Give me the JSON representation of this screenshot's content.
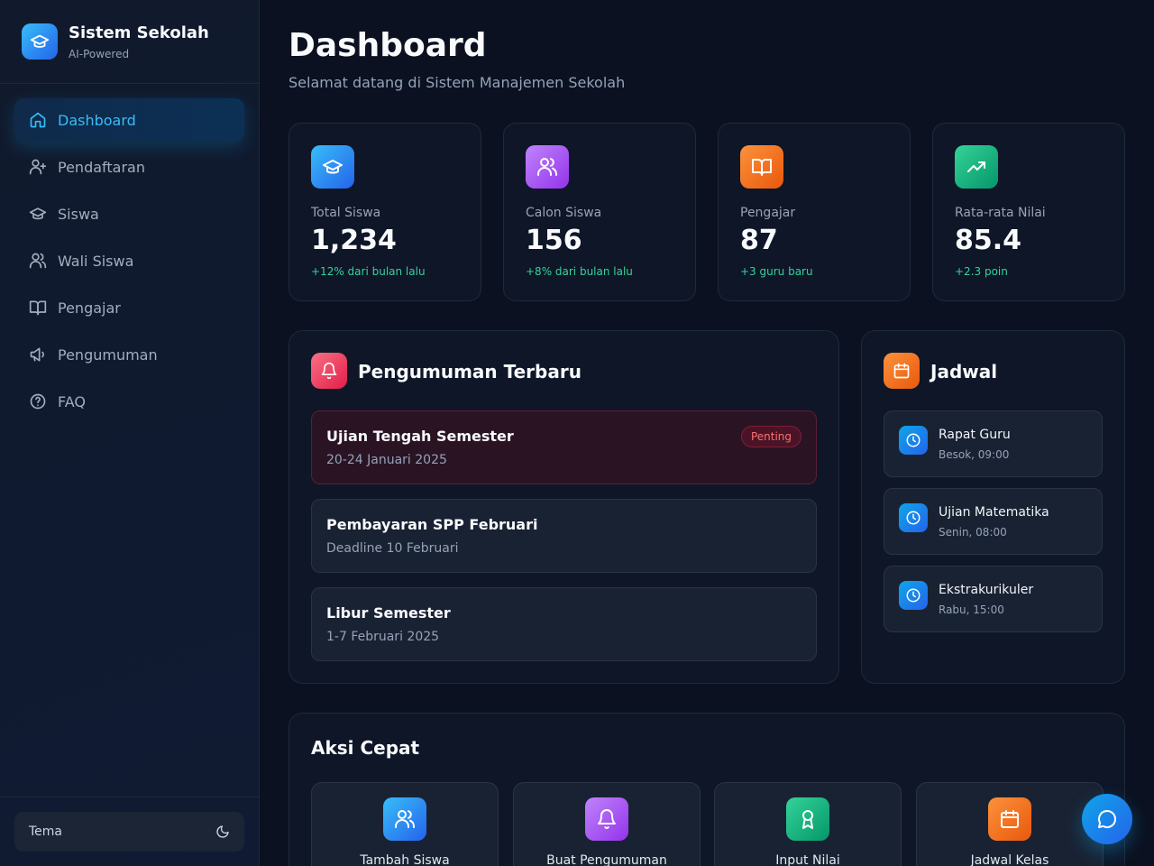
{
  "brand": {
    "title": "Sistem Sekolah",
    "subtitle": "AI-Powered"
  },
  "nav": [
    {
      "label": "Dashboard",
      "icon": "home-icon",
      "active": true
    },
    {
      "label": "Pendaftaran",
      "icon": "user-plus-icon"
    },
    {
      "label": "Siswa",
      "icon": "graduation-cap-icon"
    },
    {
      "label": "Wali Siswa",
      "icon": "users-icon"
    },
    {
      "label": "Pengajar",
      "icon": "book-open-icon"
    },
    {
      "label": "Pengumuman",
      "icon": "megaphone-icon"
    },
    {
      "label": "FAQ",
      "icon": "help-circle-icon"
    }
  ],
  "theme": {
    "label": "Tema",
    "icon": "moon-icon"
  },
  "header": {
    "title": "Dashboard",
    "subtitle": "Selamat datang di Sistem Manajemen Sekolah"
  },
  "stats": [
    {
      "label": "Total Siswa",
      "value": "1,234",
      "delta": "+12% dari bulan lalu",
      "icon": "graduation-cap-icon",
      "color": "#0ea5e9"
    },
    {
      "label": "Calon Siswa",
      "value": "156",
      "delta": "+8% dari bulan lalu",
      "icon": "users-icon",
      "color": "#a855f7"
    },
    {
      "label": "Pengajar",
      "value": "87",
      "delta": "+3 guru baru",
      "icon": "book-open-icon",
      "color": "#f97316"
    },
    {
      "label": "Rata-rata Nilai",
      "value": "85.4",
      "delta": "+2.3 poin",
      "icon": "trending-up-icon",
      "color": "#10b981"
    }
  ],
  "announcements": {
    "title": "Pengumuman Terbaru",
    "items": [
      {
        "title": "Ujian Tengah Semester",
        "date": "20-24 Januari 2025",
        "badge": "Penting"
      },
      {
        "title": "Pembayaran SPP Februari",
        "date": "Deadline 10 Februari"
      },
      {
        "title": "Libur Semester",
        "date": "1-7 Februari 2025"
      }
    ]
  },
  "schedule": {
    "title": "Jadwal",
    "items": [
      {
        "title": "Rapat Guru",
        "time": "Besok, 09:00"
      },
      {
        "title": "Ujian Matematika",
        "time": "Senin, 08:00"
      },
      {
        "title": "Ekstrakurikuler",
        "time": "Rabu, 15:00"
      }
    ]
  },
  "quick_actions": {
    "title": "Aksi Cepat",
    "items": [
      {
        "label": "Tambah Siswa",
        "icon": "users-icon",
        "color": "#0ea5e9"
      },
      {
        "label": "Buat Pengumuman",
        "icon": "bell-icon",
        "color": "#a855f7"
      },
      {
        "label": "Input Nilai",
        "icon": "award-icon",
        "color": "#10b981"
      },
      {
        "label": "Jadwal Kelas",
        "icon": "calendar-icon",
        "color": "#f97316"
      }
    ]
  },
  "colors": {
    "accent": "#38bdf8",
    "background": "#0b1120",
    "success": "#34d399",
    "danger": "#f87171"
  }
}
